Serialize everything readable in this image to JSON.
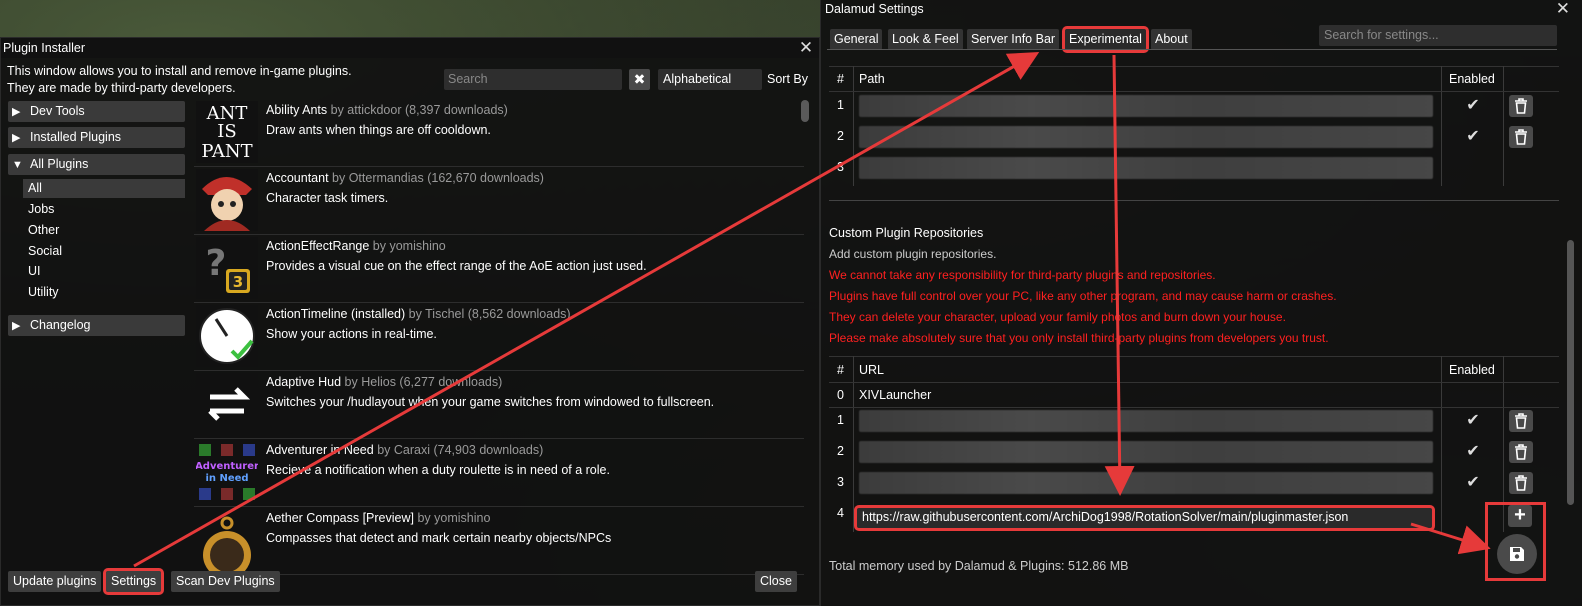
{
  "installer": {
    "title": "Plugin Installer",
    "desc_line1": "This window allows you to install and remove in-game plugins.",
    "desc_line2": "They are made by third-party developers.",
    "search_placeholder": "Search",
    "clear_label": "✖",
    "sort_value": "Alphabetical",
    "sort_label": "Sort By",
    "categories": {
      "dev_tools": "Dev Tools",
      "installed": "Installed Plugins",
      "all_plugins": "All Plugins",
      "changelog": "Changelog"
    },
    "subcategories": [
      "All",
      "Jobs",
      "Other",
      "Social",
      "UI",
      "Utility"
    ],
    "plugins": [
      {
        "name": "Ability Ants",
        "meta": "by attickdoor (8,397 downloads)",
        "desc": "Draw ants when things are off cooldown.",
        "thumb_text": "ANT IS PANT"
      },
      {
        "name": "Accountant",
        "meta": "by Ottermandias (162,670 downloads)",
        "desc": "Character task timers."
      },
      {
        "name": "ActionEffectRange",
        "meta": "by yomishino",
        "desc": "Provides a visual cue on the effect range of the AoE action just used.",
        "thumb_text": "3"
      },
      {
        "name": "ActionTimeline (installed)",
        "meta": "by Tischel (8,562 downloads)",
        "desc": "Show your actions in real-time."
      },
      {
        "name": "Adaptive Hud",
        "meta": "by Helios (6,277 downloads)",
        "desc": "Switches your /hudlayout when your game switches from windowed to fullscreen."
      },
      {
        "name": "Adventurer in Need",
        "meta": "by Caraxi (74,903 downloads)",
        "desc": "Recieve a notification when a duty roulette is in need of a role.",
        "thumb_text": "Adventurer in Need"
      },
      {
        "name": "Aether Compass [Preview]",
        "meta": "by yomishino",
        "desc": "Compasses that detect and mark certain nearby objects/NPCs"
      }
    ],
    "buttons": {
      "update": "Update plugins",
      "settings": "Settings",
      "scan": "Scan Dev Plugins",
      "close": "Close"
    }
  },
  "settings": {
    "title": "Dalamud Settings",
    "tabs": [
      "General",
      "Look & Feel",
      "Server Info Bar",
      "Experimental",
      "About"
    ],
    "active_tab": "Experimental",
    "search_placeholder": "Search for settings...",
    "dev_table": {
      "col_num": "#",
      "col_path": "Path",
      "col_enabled": "Enabled",
      "rows": [
        "1",
        "2",
        "3"
      ]
    },
    "custom_repos": {
      "title": "Custom Plugin Repositories",
      "subtitle": "Add custom plugin repositories.",
      "warnings": [
        "We cannot take any responsibility for third-party plugins and repositories.",
        "Plugins have full control over your PC, like any other program, and may cause harm or crashes.",
        "They can delete your character, upload your family photos and burn down your house.",
        "Please make absolutely sure that you only install third-party plugins from developers you trust."
      ],
      "col_num": "#",
      "col_url": "URL",
      "col_enabled": "Enabled",
      "row0_num": "0",
      "row0_url": "XIVLauncher",
      "row_nums": [
        "1",
        "2",
        "3"
      ],
      "new_num": "4",
      "new_url": "https://raw.githubusercontent.com/ArchiDog1998/RotationSolver/main/pluginmaster.json",
      "add_label": "+"
    },
    "memory": "Total memory used by Dalamud & Plugins: 512.86 MB"
  },
  "colors": {
    "highlight": "#e63a3a",
    "warning": "#ff2020"
  }
}
